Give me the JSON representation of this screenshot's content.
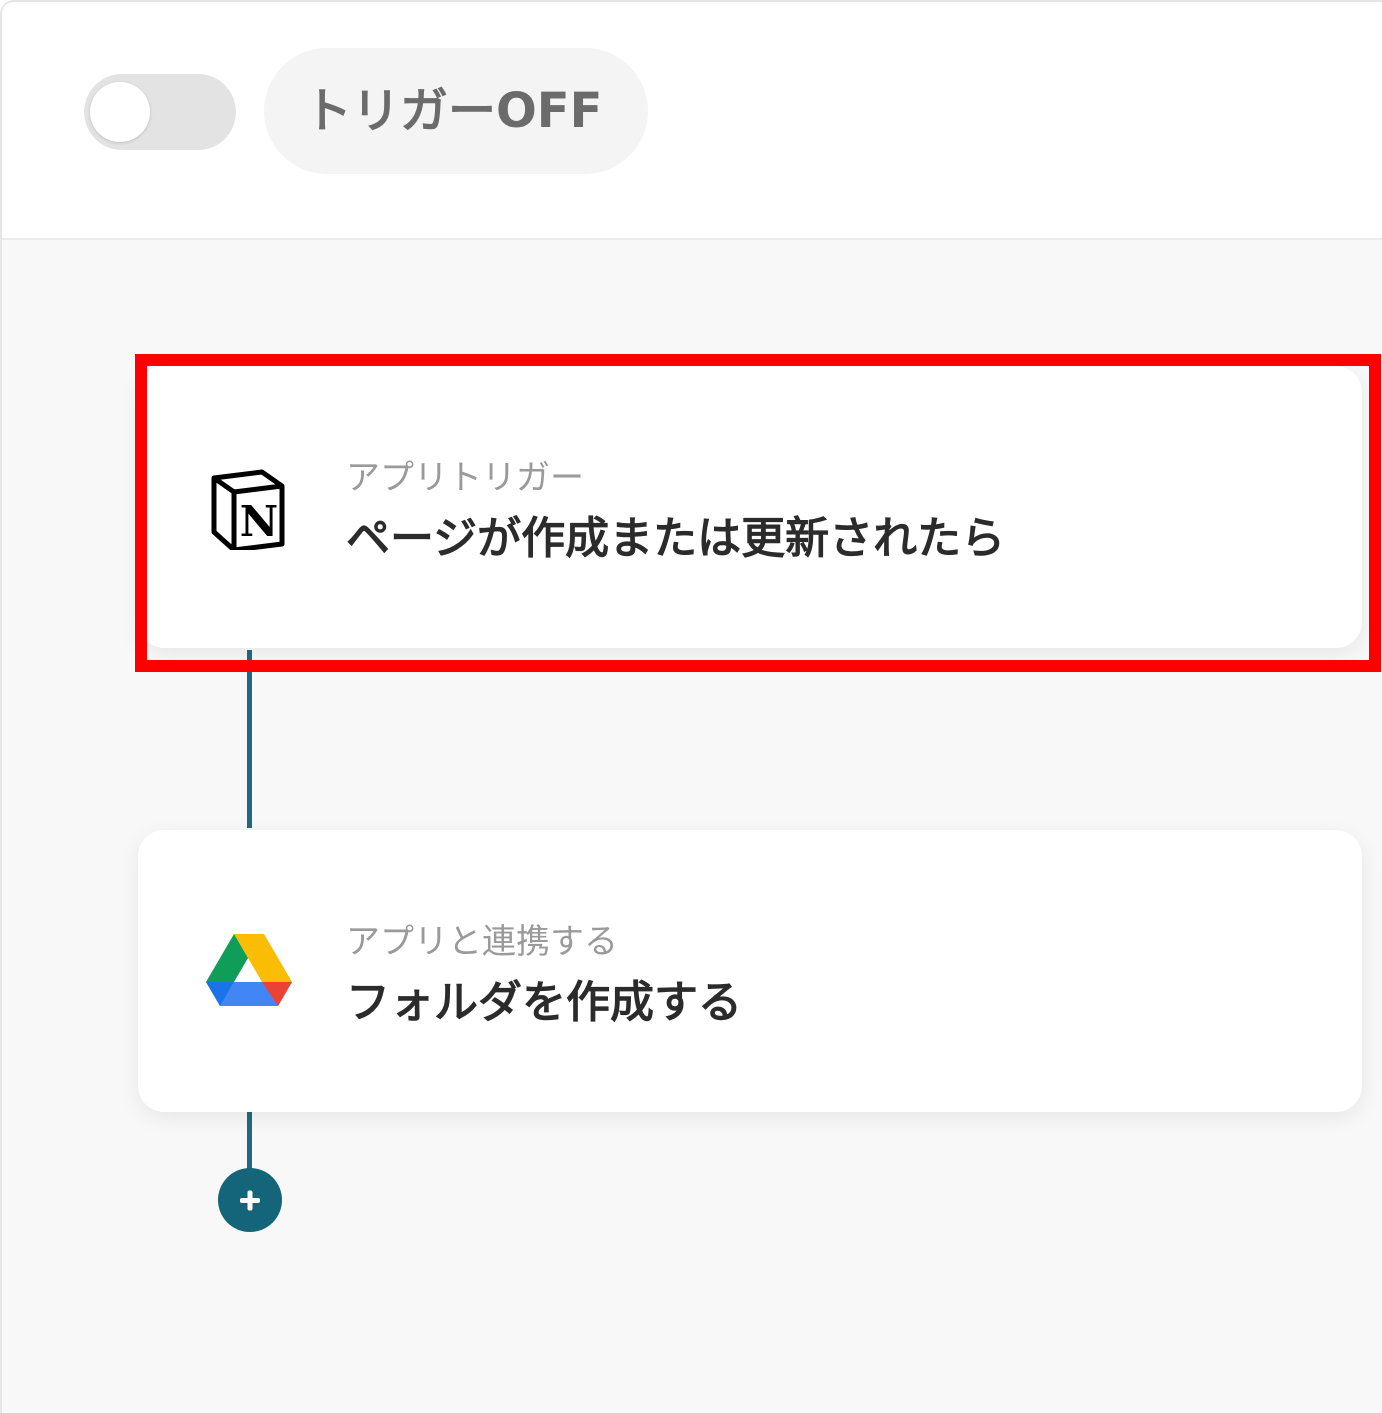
{
  "header": {
    "toggle_state": "off",
    "trigger_label": "トリガーOFF"
  },
  "steps": [
    {
      "app_icon": "notion-icon",
      "subtitle": "アプリトリガー",
      "title": "ページが作成または更新されたら",
      "highlighted": true
    },
    {
      "app_icon": "google-drive-icon",
      "subtitle": "アプリと連携する",
      "title": "フォルダを作成する",
      "highlighted": false
    }
  ],
  "add_step": {
    "icon": "plus-icon"
  },
  "colors": {
    "connector": "#1f6a80",
    "add_button": "#14657a",
    "highlight": "#ff0000",
    "toggle_off": "#e3e3e3"
  }
}
